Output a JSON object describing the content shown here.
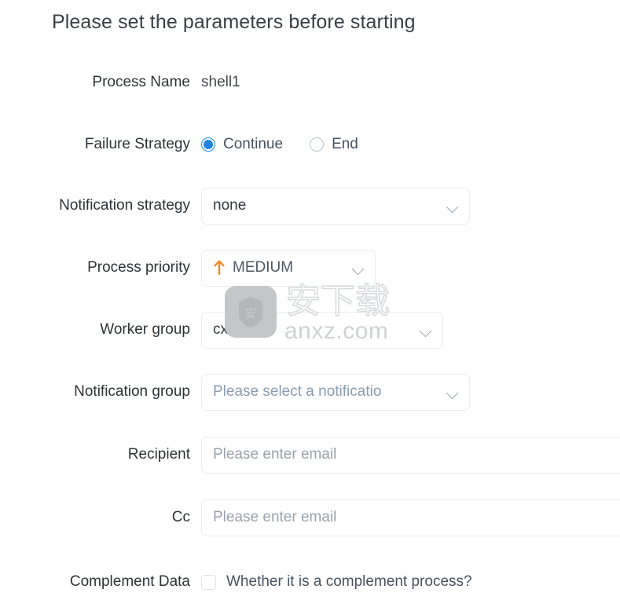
{
  "dialog": {
    "title": "Please set the parameters before starting"
  },
  "fields": {
    "process_name": {
      "label": "Process Name",
      "value": "shell1"
    },
    "failure_strategy": {
      "label": "Failure Strategy",
      "options": [
        {
          "label": "Continue",
          "selected": true
        },
        {
          "label": "End",
          "selected": false
        }
      ]
    },
    "notification_strategy": {
      "label": "Notification strategy",
      "value": "none"
    },
    "process_priority": {
      "label": "Process priority",
      "value": "MEDIUM",
      "icon": "arrow-up-icon",
      "icon_color": "#f08a24"
    },
    "worker_group": {
      "label": "Worker group",
      "value": "cxc"
    },
    "notification_group": {
      "label": "Notification group",
      "placeholder": "Please select a notificatio"
    },
    "recipient": {
      "label": "Recipient",
      "placeholder": "Please enter email",
      "value": ""
    },
    "cc": {
      "label": "Cc",
      "placeholder": "Please enter email",
      "value": ""
    },
    "complement_data": {
      "label": "Complement Data",
      "checkbox_label": "Whether it is a complement process?",
      "checked": false
    }
  },
  "watermark": {
    "chars": "安下载",
    "domain": "anxz.com",
    "logo_glyph": "安"
  },
  "colors": {
    "accent_blue": "#2186e0",
    "priority_orange": "#f08a24",
    "label_text": "#2f3338",
    "placeholder": "#9aa2ab",
    "border": "#e9ecf0"
  }
}
